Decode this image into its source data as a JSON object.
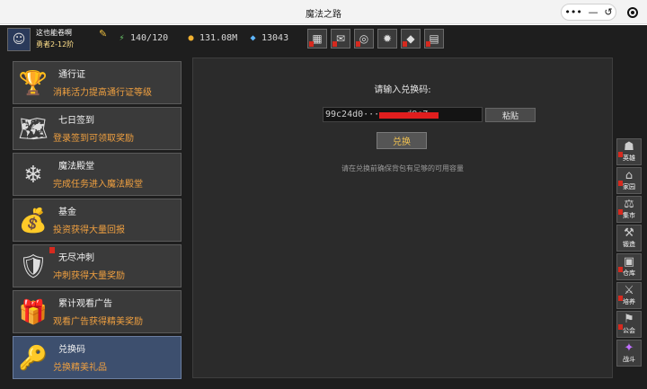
{
  "window": {
    "title": "魔法之路",
    "capsule_more": "•••",
    "capsule_min": "—",
    "capsule_restore": "↺"
  },
  "player": {
    "name": "这也能卷啊",
    "rank": "勇者2-12阶",
    "energy": "140/120",
    "gold": "131.08M",
    "gems": "13043"
  },
  "hud_icons": [
    {
      "name": "chest",
      "glyph": "▦"
    },
    {
      "name": "mail",
      "glyph": "✉"
    },
    {
      "name": "controller",
      "glyph": "◎"
    },
    {
      "name": "gear",
      "glyph": "✹"
    },
    {
      "name": "pet",
      "glyph": "◆"
    },
    {
      "name": "scroll",
      "glyph": "▤"
    }
  ],
  "menu": [
    {
      "title": "通行证",
      "desc": "消耗活力提高通行证等级",
      "icon": "trophy-icon",
      "glyph": "🏆",
      "badge": false,
      "active": false
    },
    {
      "title": "七日签到",
      "desc": "登录签到可领取奖励",
      "icon": "map-icon",
      "glyph": "🗺",
      "badge": false,
      "active": false
    },
    {
      "title": "魔法殿堂",
      "desc": "完成任务进入魔法殿堂",
      "icon": "crystal-icon",
      "glyph": "❄",
      "badge": false,
      "active": false
    },
    {
      "title": "基金",
      "desc": "投资获得大量回报",
      "icon": "fund-icon",
      "glyph": "💰",
      "badge": false,
      "active": false
    },
    {
      "title": "无尽冲刺",
      "desc": "冲刺获得大量奖励",
      "icon": "knight-icon",
      "glyph": "🛡",
      "badge": true,
      "active": false
    },
    {
      "title": "累计观看广告",
      "desc": "观看广告获得精美奖励",
      "icon": "treasure-chest-icon",
      "glyph": "🎁",
      "badge": false,
      "active": false
    },
    {
      "title": "兑换码",
      "desc": "兑换精美礼品",
      "icon": "key-icon",
      "glyph": "🔑",
      "badge": false,
      "active": true
    }
  ],
  "redeem": {
    "prompt": "请输入兑换码:",
    "code_value": "99c24d0········d9e7",
    "paste_label": "粘贴",
    "redeem_label": "兑换",
    "hint": "请在兑换前确保背包有足够的可用容量"
  },
  "sidebar": [
    {
      "label": "英雄",
      "icon": "hero-icon",
      "glyph": "☗",
      "badge": true
    },
    {
      "label": "家园",
      "icon": "home-icon",
      "glyph": "⌂",
      "badge": true
    },
    {
      "label": "集市",
      "icon": "market-icon",
      "glyph": "⚖",
      "badge": true
    },
    {
      "label": "锻造",
      "icon": "anvil-icon",
      "glyph": "⚒",
      "badge": false
    },
    {
      "label": "仓库",
      "icon": "warehouse-icon",
      "glyph": "▣",
      "badge": true
    },
    {
      "label": "培养",
      "icon": "train-icon",
      "glyph": "⚔",
      "badge": true
    },
    {
      "label": "公会",
      "icon": "guild-icon",
      "glyph": "⚑",
      "badge": true
    },
    {
      "label": "战斗",
      "icon": "battle-icon",
      "glyph": "✦",
      "badge": false
    }
  ]
}
